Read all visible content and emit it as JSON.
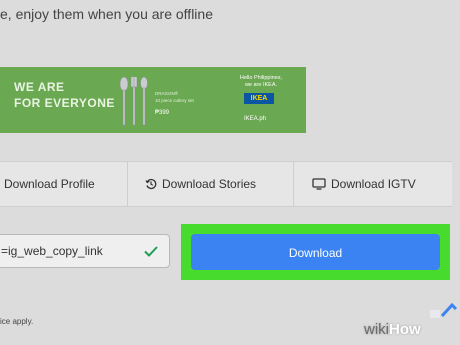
{
  "intro": {
    "tagline": "e, enjoy them when you are offline"
  },
  "ad": {
    "headline_1": "WE ARE",
    "headline_2": "FOR EVERYONE",
    "product_line_1": "DRAGON®",
    "product_line_2": "10 piece cutlery set",
    "price": "₱399",
    "greeting_line_1": "Hello Philippines,",
    "greeting_line_2": "we are IKEA.",
    "logo": "IKEA",
    "site": "IKEA.ph",
    "background": "#6ba852"
  },
  "tabs": [
    {
      "label": "Download Profile",
      "icon": "user-icon"
    },
    {
      "label": "Download Stories",
      "icon": "history-icon"
    },
    {
      "label": "Download IGTV",
      "icon": "monitor-icon"
    }
  ],
  "form": {
    "link_value": "=ig_web_copy_link",
    "check_icon": "check-icon",
    "download_label": "Download",
    "button_color": "#3b82f2",
    "highlight_color": "#47dc2d"
  },
  "footer": {
    "text": "ice apply."
  },
  "watermark": {
    "wiki": "wiki",
    "how": "How"
  }
}
